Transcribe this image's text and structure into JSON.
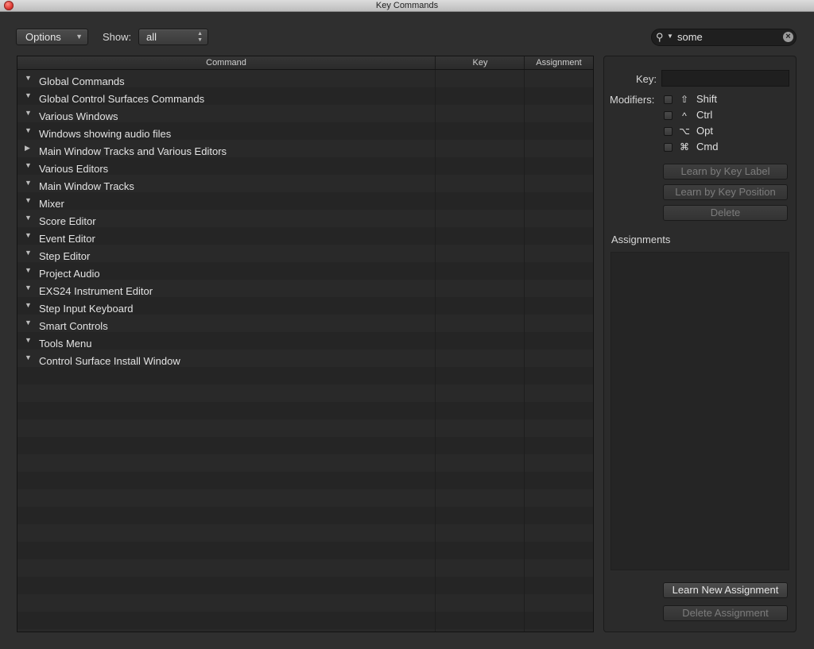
{
  "window": {
    "title": "Key Commands"
  },
  "toolbar": {
    "options_label": "Options",
    "show_label": "Show:",
    "show_value": "all",
    "search_value": "some"
  },
  "table": {
    "headers": {
      "command": "Command",
      "key": "Key",
      "assignment": "Assignment"
    },
    "rows": [
      {
        "name": "Global Commands",
        "expanded": true
      },
      {
        "name": "Global Control Surfaces Commands",
        "expanded": true
      },
      {
        "name": "Various Windows",
        "expanded": true
      },
      {
        "name": "Windows showing audio files",
        "expanded": true
      },
      {
        "name": "Main Window Tracks and Various Editors",
        "expanded": false
      },
      {
        "name": "Various Editors",
        "expanded": true
      },
      {
        "name": "Main Window Tracks",
        "expanded": true
      },
      {
        "name": "Mixer",
        "expanded": true
      },
      {
        "name": "Score Editor",
        "expanded": true
      },
      {
        "name": "Event Editor",
        "expanded": true
      },
      {
        "name": "Step Editor",
        "expanded": true
      },
      {
        "name": "Project Audio",
        "expanded": true
      },
      {
        "name": "EXS24 Instrument Editor",
        "expanded": true
      },
      {
        "name": "Step Input Keyboard",
        "expanded": true
      },
      {
        "name": "Smart Controls",
        "expanded": true
      },
      {
        "name": "Tools Menu",
        "expanded": true
      },
      {
        "name": "Control Surface Install Window",
        "expanded": true
      }
    ]
  },
  "panel": {
    "key_label": "Key:",
    "modifiers_label": "Modifiers:",
    "modifiers": [
      {
        "symbol": "⇧",
        "name": "Shift",
        "checked": false
      },
      {
        "symbol": "^",
        "name": "Ctrl",
        "checked": false
      },
      {
        "symbol": "⌥",
        "name": "Opt",
        "checked": false
      },
      {
        "symbol": "⌘",
        "name": "Cmd",
        "checked": false
      }
    ],
    "learn_label_btn": "Learn by Key Label",
    "learn_position_btn": "Learn by Key Position",
    "delete_btn": "Delete",
    "assignments_label": "Assignments",
    "learn_new_btn": "Learn New Assignment",
    "delete_assignment_btn": "Delete Assignment"
  }
}
